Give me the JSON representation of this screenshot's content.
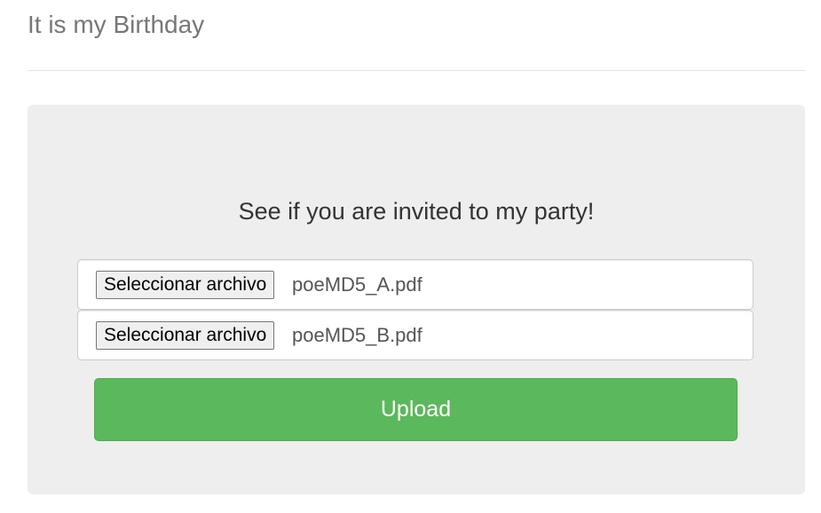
{
  "header": {
    "title": "It is my Birthday"
  },
  "main": {
    "heading": "See if you are invited to my party!",
    "files": [
      {
        "button_label": "Seleccionar archivo",
        "file_name": "poeMD5_A.pdf"
      },
      {
        "button_label": "Seleccionar archivo",
        "file_name": "poeMD5_B.pdf"
      }
    ],
    "upload_label": "Upload"
  },
  "colors": {
    "upload_button": "#5cb85c",
    "panel_background": "#eeeeee",
    "title_text": "#777777"
  }
}
